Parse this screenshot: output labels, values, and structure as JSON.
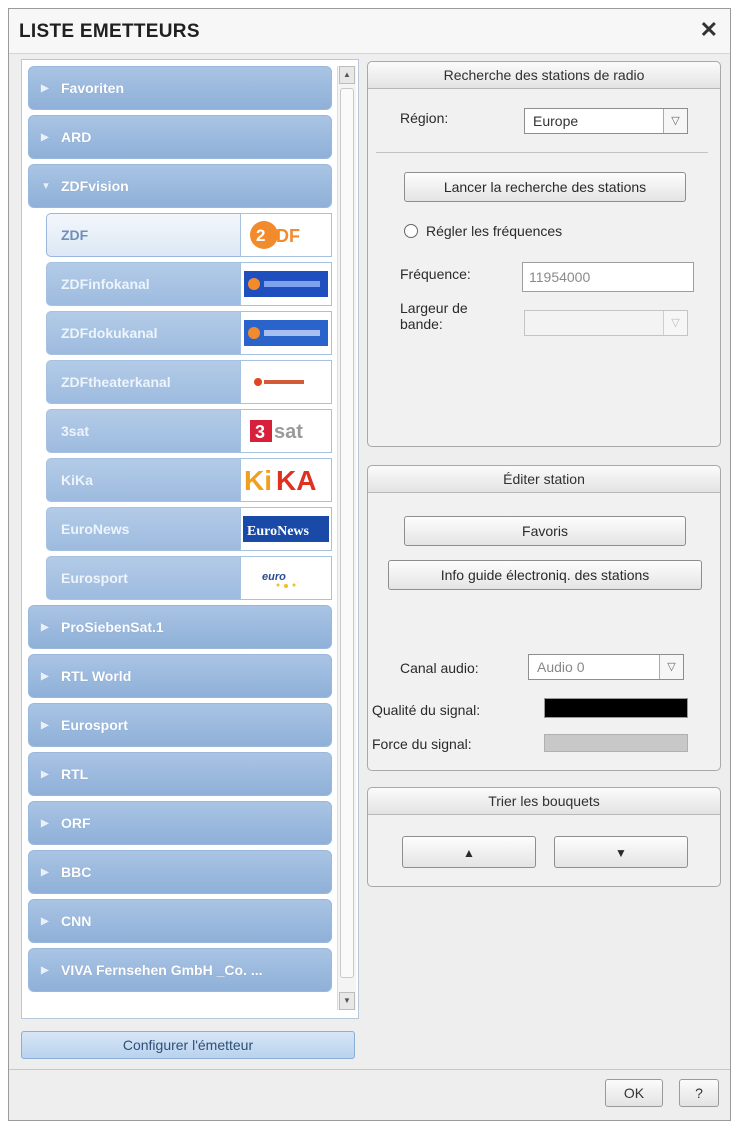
{
  "window": {
    "title": "LISTE EMETTEURS",
    "close_label": "✕"
  },
  "groups_top": [
    {
      "label": "Favoriten"
    },
    {
      "label": "ARD"
    }
  ],
  "expanded_group": {
    "label": "ZDFvision"
  },
  "stations": [
    {
      "label": "ZDF",
      "logo": "ZDF",
      "selected": true
    },
    {
      "label": "ZDFinfokanal",
      "logo": "ZDFinfokanal"
    },
    {
      "label": "ZDFdokukanal",
      "logo": "ZDFdokukanal"
    },
    {
      "label": "ZDFtheaterkanal",
      "logo": "ZDFtheaterkanal"
    },
    {
      "label": "3sat",
      "logo": "3sat"
    },
    {
      "label": "KiKa",
      "logo": "KiKA"
    },
    {
      "label": "EuroNews",
      "logo": "EuroNews"
    },
    {
      "label": "Eurosport",
      "logo": "eurosport"
    }
  ],
  "groups_bottom": [
    {
      "label": "ProSiebenSat.1"
    },
    {
      "label": "RTL World"
    },
    {
      "label": "Eurosport"
    },
    {
      "label": "RTL"
    },
    {
      "label": "ORF"
    },
    {
      "label": "BBC"
    },
    {
      "label": "CNN"
    },
    {
      "label": "VIVA Fernsehen GmbH _Co. ..."
    }
  ],
  "config_button": "Configurer l'émetteur",
  "search_panel": {
    "title": "Recherche des stations de radio",
    "region_label": "Région:",
    "region_value": "Europe",
    "search_button": "Lancer la recherche des stations",
    "freq_radio_label": "Régler les fréquences",
    "frequency_label": "Fréquence:",
    "frequency_value": "11954000",
    "bandwidth_label": "Largeur de bande:",
    "bandwidth_value": ""
  },
  "edit_panel": {
    "title": "Éditer station",
    "favorites_button": "Favoris",
    "epg_button": "Info guide électroniq. des stations",
    "audio_label": "Canal audio:",
    "audio_value": "Audio 0",
    "quality_label": "Qualité du signal:",
    "strength_label": "Force du signal:",
    "quality_level": 1.0,
    "strength_level": 0.0
  },
  "sort_panel": {
    "title": "Trier les bouquets",
    "up_icon": "▲",
    "down_icon": "▼"
  },
  "footer": {
    "ok_label": "OK",
    "help_label": "?"
  },
  "colors": {
    "group_bg": "#9fbbe0",
    "selected_station_bg": "#e6eef8",
    "quality_bar": "#000000",
    "strength_bar": "#c8c8c8"
  }
}
